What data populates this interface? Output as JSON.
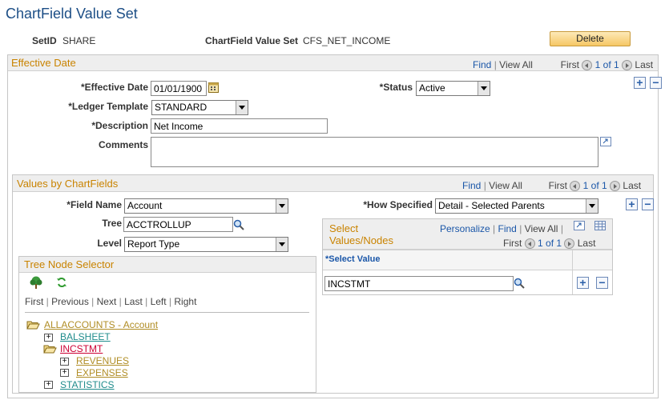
{
  "page": {
    "title": "ChartField Value Set",
    "setid_label": "SetID",
    "setid_value": "SHARE",
    "valueset_label": "ChartField Value Set",
    "valueset_value": "CFS_NET_INCOME",
    "delete_label": "Delete"
  },
  "effective": {
    "title": "Effective Date",
    "nav": {
      "find": "Find",
      "sep": "|",
      "viewall": "View All",
      "first": "First",
      "count": "1 of 1",
      "last": "Last"
    },
    "effdate_label": "*Effective Date",
    "effdate_value": "01/01/1900",
    "status_label": "*Status",
    "status_value": "Active",
    "ledger_label": "*Ledger Template",
    "ledger_value": "STANDARD",
    "desc_label": "*Description",
    "desc_value": "Net Income",
    "comments_label": "Comments",
    "comments_value": ""
  },
  "values": {
    "title": "Values by ChartFields",
    "nav": {
      "find": "Find",
      "sep": "|",
      "viewall": "View All",
      "first": "First",
      "count": "1 of 1",
      "last": "Last"
    },
    "field_label": "*Field Name",
    "field_value": "Account",
    "how_label": "*How Specified",
    "how_value": "Detail - Selected Parents",
    "tree_label": "Tree",
    "tree_value": "ACCTROLLUP",
    "level_label": "Level",
    "level_value": "Report Type"
  },
  "tree_selector": {
    "title": "Tree Node Selector",
    "nav": {
      "first": "First",
      "previous": "Previous",
      "next": "Next",
      "last": "Last",
      "left": "Left",
      "right": "Right"
    },
    "nodes": [
      {
        "label": "ALLACCOUNTS - Account",
        "color": "#b08d25"
      },
      {
        "label": "BALSHEET",
        "color": "#1f8c8c"
      },
      {
        "label": "INCSTMT",
        "color": "#cc0033"
      },
      {
        "label": "REVENUES",
        "color": "#b08d25"
      },
      {
        "label": "EXPENSES",
        "color": "#b08d25"
      },
      {
        "label": "STATISTICS",
        "color": "#1f8c8c"
      }
    ]
  },
  "select_values": {
    "title_line1": "Select",
    "title_line2": "Values/Nodes",
    "personalize": "Personalize",
    "find": "Find",
    "viewall": "View All",
    "first": "First",
    "count": "1 of 1",
    "last": "Last",
    "col_header": "*Select Value",
    "row_value": "INCSTMT"
  },
  "colors": {
    "title": "#1c4e86",
    "section_title": "#c98300",
    "link": "#1a56a8"
  }
}
